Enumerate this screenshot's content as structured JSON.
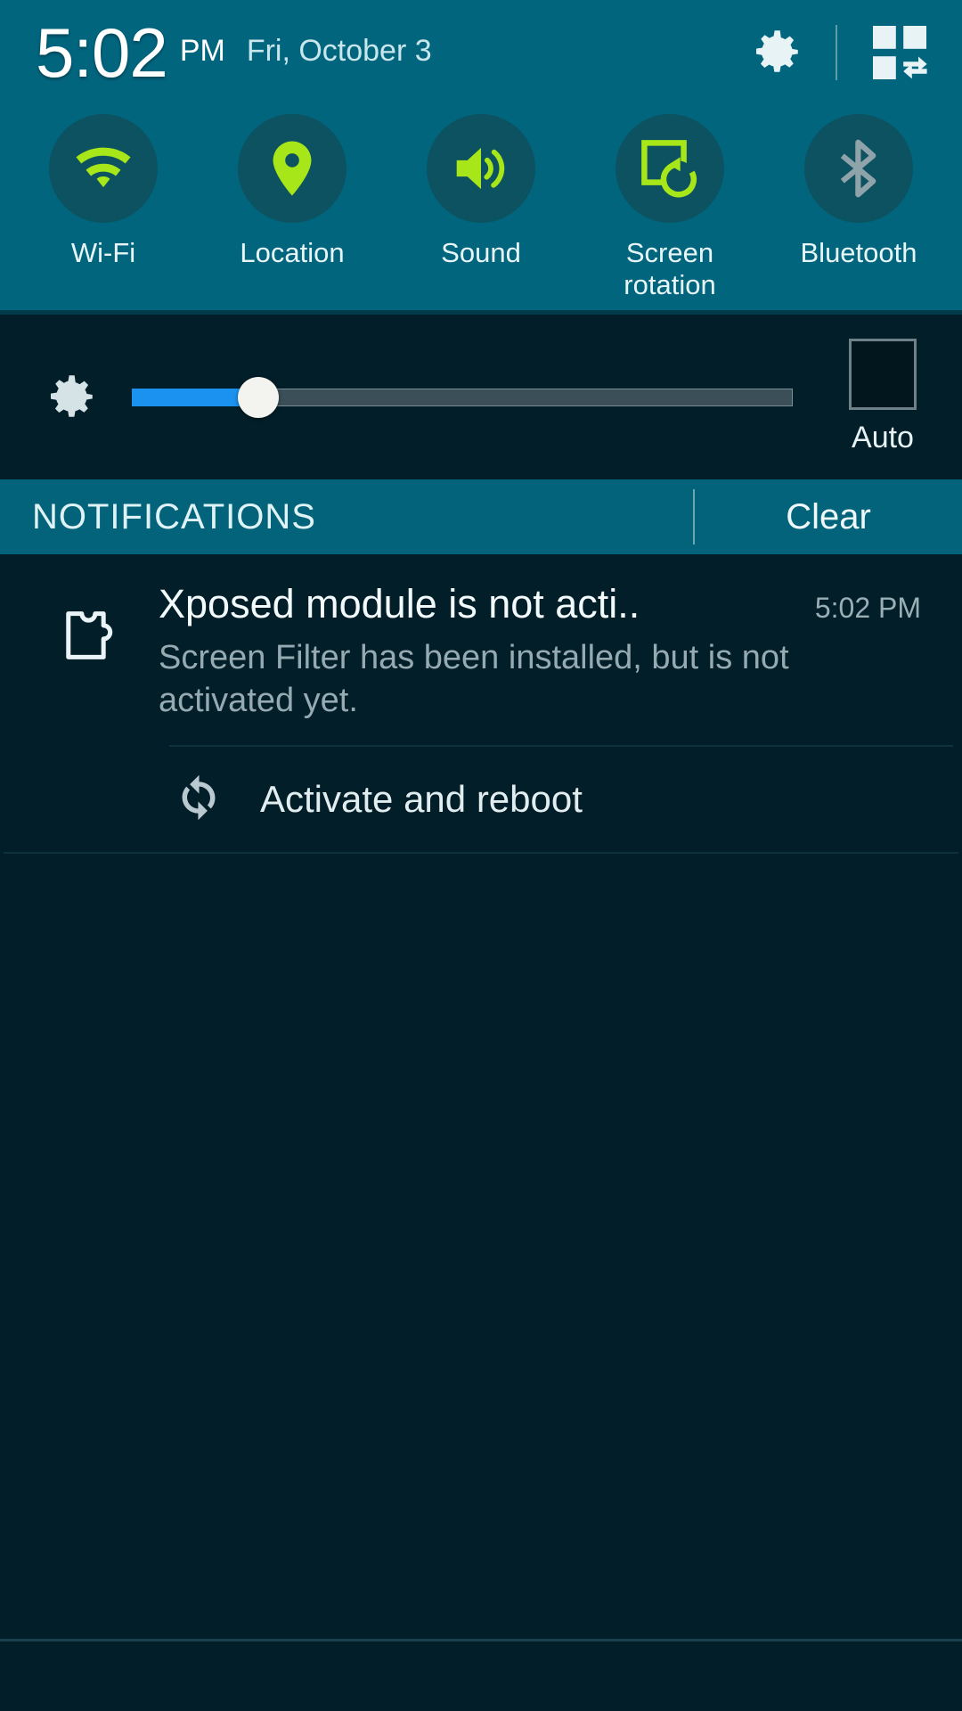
{
  "colors": {
    "panel_teal": "#02657e",
    "notif_header_teal": "#03637a",
    "body_dark": "#021e28",
    "toggle_circle": "#0c5260",
    "accent_green": "#a7e618",
    "disabled_grey": "#8fa3aa",
    "slider_blue": "#1b92f0"
  },
  "status_bar": {
    "time": "5:02",
    "ampm": "PM",
    "date": "Fri, October 3",
    "settings_icon": "gear-icon",
    "quick_settings_icon": "quick-settings-grid-icon"
  },
  "quick_toggles": [
    {
      "label": "Wi-Fi",
      "icon": "wifi-icon",
      "state": "on"
    },
    {
      "label": "Location",
      "icon": "location-pin-icon",
      "state": "on"
    },
    {
      "label": "Sound",
      "icon": "sound-speaker-icon",
      "state": "on"
    },
    {
      "label": "Screen\nrotation",
      "icon": "screen-rotation-icon",
      "state": "on"
    },
    {
      "label": "Bluetooth",
      "icon": "bluetooth-icon",
      "state": "off"
    }
  ],
  "brightness": {
    "icon": "brightness-gear-icon",
    "value_percent": 17,
    "auto_label": "Auto",
    "auto_checked": false
  },
  "notifications_header": {
    "title": "NOTIFICATIONS",
    "clear_label": "Clear"
  },
  "notification": {
    "icon": "puzzle-piece-icon",
    "title": "Xposed module is not acti..",
    "time": "5:02 PM",
    "text": "Screen Filter has been installed, but is not activated yet.",
    "action": {
      "icon": "refresh-sync-icon",
      "label": "Activate and reboot"
    }
  }
}
